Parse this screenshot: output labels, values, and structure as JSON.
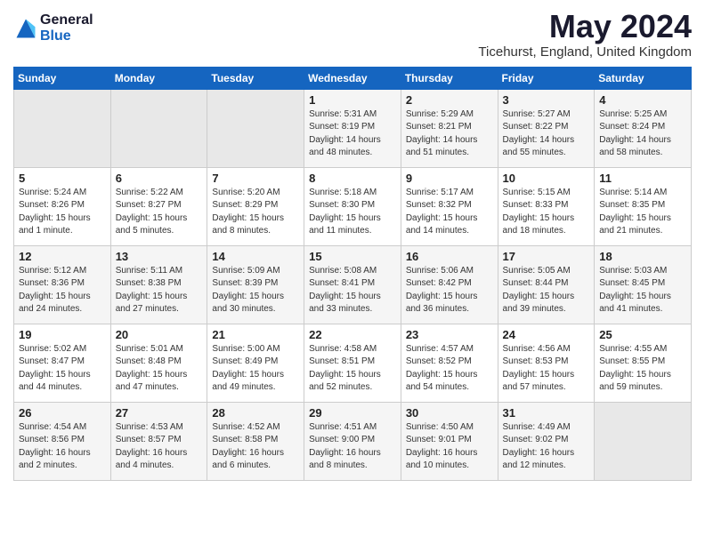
{
  "header": {
    "logo_general": "General",
    "logo_blue": "Blue",
    "month_title": "May 2024",
    "location": "Ticehurst, England, United Kingdom"
  },
  "days_of_week": [
    "Sunday",
    "Monday",
    "Tuesday",
    "Wednesday",
    "Thursday",
    "Friday",
    "Saturday"
  ],
  "weeks": [
    [
      {
        "day": "",
        "info": ""
      },
      {
        "day": "",
        "info": ""
      },
      {
        "day": "",
        "info": ""
      },
      {
        "day": "1",
        "info": "Sunrise: 5:31 AM\nSunset: 8:19 PM\nDaylight: 14 hours\nand 48 minutes."
      },
      {
        "day": "2",
        "info": "Sunrise: 5:29 AM\nSunset: 8:21 PM\nDaylight: 14 hours\nand 51 minutes."
      },
      {
        "day": "3",
        "info": "Sunrise: 5:27 AM\nSunset: 8:22 PM\nDaylight: 14 hours\nand 55 minutes."
      },
      {
        "day": "4",
        "info": "Sunrise: 5:25 AM\nSunset: 8:24 PM\nDaylight: 14 hours\nand 58 minutes."
      }
    ],
    [
      {
        "day": "5",
        "info": "Sunrise: 5:24 AM\nSunset: 8:26 PM\nDaylight: 15 hours\nand 1 minute."
      },
      {
        "day": "6",
        "info": "Sunrise: 5:22 AM\nSunset: 8:27 PM\nDaylight: 15 hours\nand 5 minutes."
      },
      {
        "day": "7",
        "info": "Sunrise: 5:20 AM\nSunset: 8:29 PM\nDaylight: 15 hours\nand 8 minutes."
      },
      {
        "day": "8",
        "info": "Sunrise: 5:18 AM\nSunset: 8:30 PM\nDaylight: 15 hours\nand 11 minutes."
      },
      {
        "day": "9",
        "info": "Sunrise: 5:17 AM\nSunset: 8:32 PM\nDaylight: 15 hours\nand 14 minutes."
      },
      {
        "day": "10",
        "info": "Sunrise: 5:15 AM\nSunset: 8:33 PM\nDaylight: 15 hours\nand 18 minutes."
      },
      {
        "day": "11",
        "info": "Sunrise: 5:14 AM\nSunset: 8:35 PM\nDaylight: 15 hours\nand 21 minutes."
      }
    ],
    [
      {
        "day": "12",
        "info": "Sunrise: 5:12 AM\nSunset: 8:36 PM\nDaylight: 15 hours\nand 24 minutes."
      },
      {
        "day": "13",
        "info": "Sunrise: 5:11 AM\nSunset: 8:38 PM\nDaylight: 15 hours\nand 27 minutes."
      },
      {
        "day": "14",
        "info": "Sunrise: 5:09 AM\nSunset: 8:39 PM\nDaylight: 15 hours\nand 30 minutes."
      },
      {
        "day": "15",
        "info": "Sunrise: 5:08 AM\nSunset: 8:41 PM\nDaylight: 15 hours\nand 33 minutes."
      },
      {
        "day": "16",
        "info": "Sunrise: 5:06 AM\nSunset: 8:42 PM\nDaylight: 15 hours\nand 36 minutes."
      },
      {
        "day": "17",
        "info": "Sunrise: 5:05 AM\nSunset: 8:44 PM\nDaylight: 15 hours\nand 39 minutes."
      },
      {
        "day": "18",
        "info": "Sunrise: 5:03 AM\nSunset: 8:45 PM\nDaylight: 15 hours\nand 41 minutes."
      }
    ],
    [
      {
        "day": "19",
        "info": "Sunrise: 5:02 AM\nSunset: 8:47 PM\nDaylight: 15 hours\nand 44 minutes."
      },
      {
        "day": "20",
        "info": "Sunrise: 5:01 AM\nSunset: 8:48 PM\nDaylight: 15 hours\nand 47 minutes."
      },
      {
        "day": "21",
        "info": "Sunrise: 5:00 AM\nSunset: 8:49 PM\nDaylight: 15 hours\nand 49 minutes."
      },
      {
        "day": "22",
        "info": "Sunrise: 4:58 AM\nSunset: 8:51 PM\nDaylight: 15 hours\nand 52 minutes."
      },
      {
        "day": "23",
        "info": "Sunrise: 4:57 AM\nSunset: 8:52 PM\nDaylight: 15 hours\nand 54 minutes."
      },
      {
        "day": "24",
        "info": "Sunrise: 4:56 AM\nSunset: 8:53 PM\nDaylight: 15 hours\nand 57 minutes."
      },
      {
        "day": "25",
        "info": "Sunrise: 4:55 AM\nSunset: 8:55 PM\nDaylight: 15 hours\nand 59 minutes."
      }
    ],
    [
      {
        "day": "26",
        "info": "Sunrise: 4:54 AM\nSunset: 8:56 PM\nDaylight: 16 hours\nand 2 minutes."
      },
      {
        "day": "27",
        "info": "Sunrise: 4:53 AM\nSunset: 8:57 PM\nDaylight: 16 hours\nand 4 minutes."
      },
      {
        "day": "28",
        "info": "Sunrise: 4:52 AM\nSunset: 8:58 PM\nDaylight: 16 hours\nand 6 minutes."
      },
      {
        "day": "29",
        "info": "Sunrise: 4:51 AM\nSunset: 9:00 PM\nDaylight: 16 hours\nand 8 minutes."
      },
      {
        "day": "30",
        "info": "Sunrise: 4:50 AM\nSunset: 9:01 PM\nDaylight: 16 hours\nand 10 minutes."
      },
      {
        "day": "31",
        "info": "Sunrise: 4:49 AM\nSunset: 9:02 PM\nDaylight: 16 hours\nand 12 minutes."
      },
      {
        "day": "",
        "info": ""
      }
    ]
  ]
}
